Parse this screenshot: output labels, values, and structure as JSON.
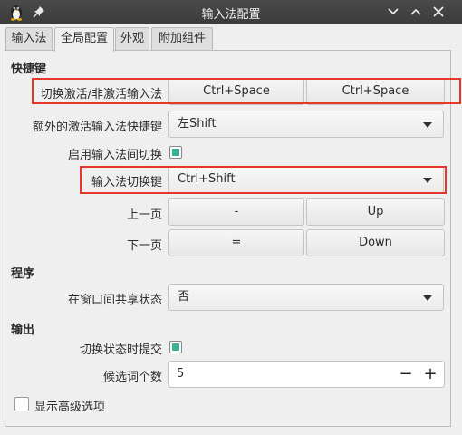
{
  "window": {
    "title": "输入法配置",
    "icons": {
      "app": "tux-penguin-icon",
      "pin": "pin-icon"
    },
    "controls": [
      "minimize-icon",
      "maximize-icon",
      "close-icon"
    ]
  },
  "tabs": [
    {
      "label": "输入法"
    },
    {
      "label": "全局配置",
      "active": true
    },
    {
      "label": "外观"
    },
    {
      "label": "附加组件"
    }
  ],
  "hotkeys": {
    "section_title": "快捷键",
    "toggle": {
      "label": "切换激活/非激活输入法",
      "key1": "Ctrl+Space",
      "key2": "Ctrl+Space"
    },
    "extra": {
      "label": "额外的激活输入法快捷键",
      "value": "左Shift"
    },
    "enable_switch": {
      "label": "启用输入法间切换",
      "checked": true
    },
    "switch_key": {
      "label": "输入法切换键",
      "value": "Ctrl+Shift"
    },
    "prev_page": {
      "label": "上一页",
      "key1": "-",
      "key2": "Up"
    },
    "next_page": {
      "label": "下一页",
      "key1": "=",
      "key2": "Down"
    }
  },
  "program": {
    "section_title": "程序",
    "share_state": {
      "label": "在窗口间共享状态",
      "value": "否"
    }
  },
  "output": {
    "section_title": "输出",
    "commit_on_switch": {
      "label": "切换状态时提交",
      "checked": true
    },
    "candidate_count": {
      "label": "候选词个数",
      "value": "5",
      "minus": "−",
      "plus": "+"
    }
  },
  "advanced": {
    "label": "显示高级选项",
    "checked": false
  },
  "colors": {
    "highlight": "#e5382d",
    "check": "#3daf95",
    "titlebar": "#3f3f3f"
  }
}
